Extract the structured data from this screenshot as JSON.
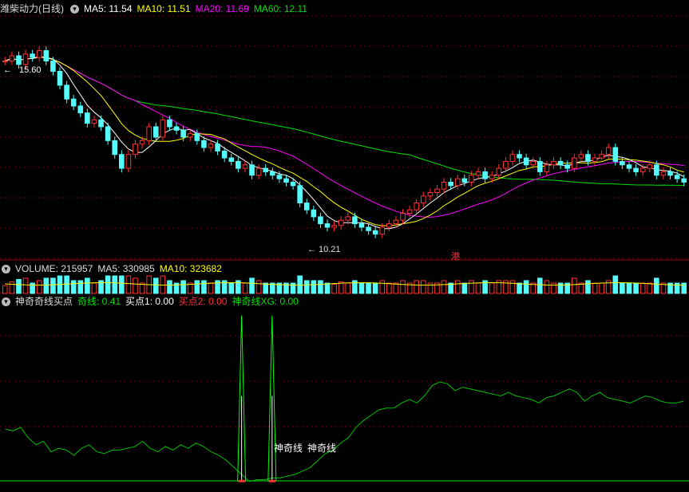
{
  "main_header": {
    "name": "潍柴动力",
    "period": "(日线)",
    "ma5": "MA5: 11.54",
    "ma10": "MA10: 11.51",
    "ma20": "MA20: 11.69",
    "ma60": "MA60: 12.11"
  },
  "volume_header": {
    "volume": "VOLUME: 215957",
    "ma5": "MA5: 330985",
    "ma10": "MA10: 323682"
  },
  "indicator_header": {
    "name": "神奇奇线买点",
    "qixian": "奇线: 0.41",
    "buy1": "买点1: 0.00",
    "buy2": "买点2: 0.00",
    "xg": "神奇线XG: 0.00"
  },
  "annotations": {
    "high_label": "15.60",
    "low_label": "10.21",
    "hk_marker": "港",
    "signal_1": "神奇线",
    "signal_2": "神奇线"
  },
  "colors": {
    "up": "#ff3232",
    "down": "#54fcfc",
    "ma5": "#ffffff",
    "ma10": "#ffff00",
    "ma20": "#ff00ff",
    "ma60": "#00e000",
    "grid": "#7a0000",
    "indicator": "#00c000"
  },
  "chart_data": [
    {
      "type": "candlestick",
      "title": "潍柴动力 (日线)",
      "ylim": [
        9.6,
        16.6
      ],
      "price_series": [
        15.3,
        15.45,
        15.2,
        15.5,
        15.4,
        15.6,
        15.3,
        15.0,
        14.6,
        14.2,
        14.0,
        13.8,
        13.5,
        13.6,
        13.4,
        13.0,
        12.6,
        12.2,
        12.6,
        12.9,
        13.0,
        13.4,
        13.1,
        13.6,
        13.4,
        13.3,
        13.1,
        13.2,
        13.0,
        12.8,
        12.9,
        12.7,
        12.5,
        12.4,
        12.2,
        12.3,
        12.0,
        12.2,
        12.1,
        12.0,
        11.9,
        11.8,
        11.7,
        11.2,
        11.0,
        10.8,
        10.6,
        10.5,
        10.55,
        10.7,
        10.8,
        10.6,
        10.5,
        10.4,
        10.3,
        10.5,
        10.6,
        10.7,
        10.9,
        11.0,
        11.2,
        11.4,
        11.5,
        11.6,
        11.8,
        11.7,
        11.9,
        11.8,
        12.0,
        12.1,
        11.9,
        12.0,
        12.2,
        12.4,
        12.6,
        12.5,
        12.3,
        12.4,
        12.1,
        12.3,
        12.4,
        12.3,
        12.2,
        12.5,
        12.6,
        12.4,
        12.5,
        12.6,
        12.8,
        12.4,
        12.3,
        12.2,
        12.1,
        12.2,
        12.3,
        12.0,
        12.1,
        12.0,
        11.9,
        11.8
      ],
      "high_label_value": 15.6,
      "low_label_value": 10.21
    },
    {
      "type": "bar",
      "title": "VOLUME",
      "current": 215957,
      "ma5": 330985,
      "ma10": 323682
    },
    {
      "type": "line",
      "title": "神奇奇线买点",
      "ylim": [
        0,
        10
      ],
      "series": [
        {
          "name": "奇线",
          "values": [
            3.1,
            3.0,
            3.2,
            2.6,
            2.2,
            2.4,
            1.8,
            2.0,
            1.9,
            1.6,
            2.0,
            2.2,
            1.8,
            1.7,
            1.9,
            1.9,
            2.0,
            2.1,
            2.4,
            2.0,
            1.8,
            2.1,
            1.9,
            2.2,
            2.0,
            2.3,
            2.1,
            1.8,
            1.6,
            1.3,
            0.9,
            0.5,
            0.1,
            0.2,
            0.2,
            0.3,
            0.3,
            0.4,
            0.5,
            0.7,
            0.9,
            1.3,
            1.7,
            1.9,
            2.3,
            2.6,
            3.2,
            3.6,
            3.9,
            4.2,
            4.3,
            4.3,
            4.6,
            4.8,
            4.6,
            5.0,
            5.6,
            5.8,
            5.7,
            5.3,
            5.5,
            5.4,
            5.3,
            5.2,
            5.1,
            5.0,
            5.2,
            5.0,
            4.9,
            4.8,
            4.6,
            4.9,
            5.0,
            5.2,
            5.4,
            5.2,
            4.7,
            5.0,
            5.2,
            4.9,
            4.8,
            4.7,
            4.6,
            4.8,
            5.0,
            4.9,
            4.7,
            4.6,
            4.6,
            4.7
          ]
        },
        {
          "name": "神奇线XG",
          "spikes": [
            {
              "index": 31,
              "value": 9.6
            },
            {
              "index": 35,
              "value": 9.6
            }
          ]
        }
      ]
    }
  ]
}
